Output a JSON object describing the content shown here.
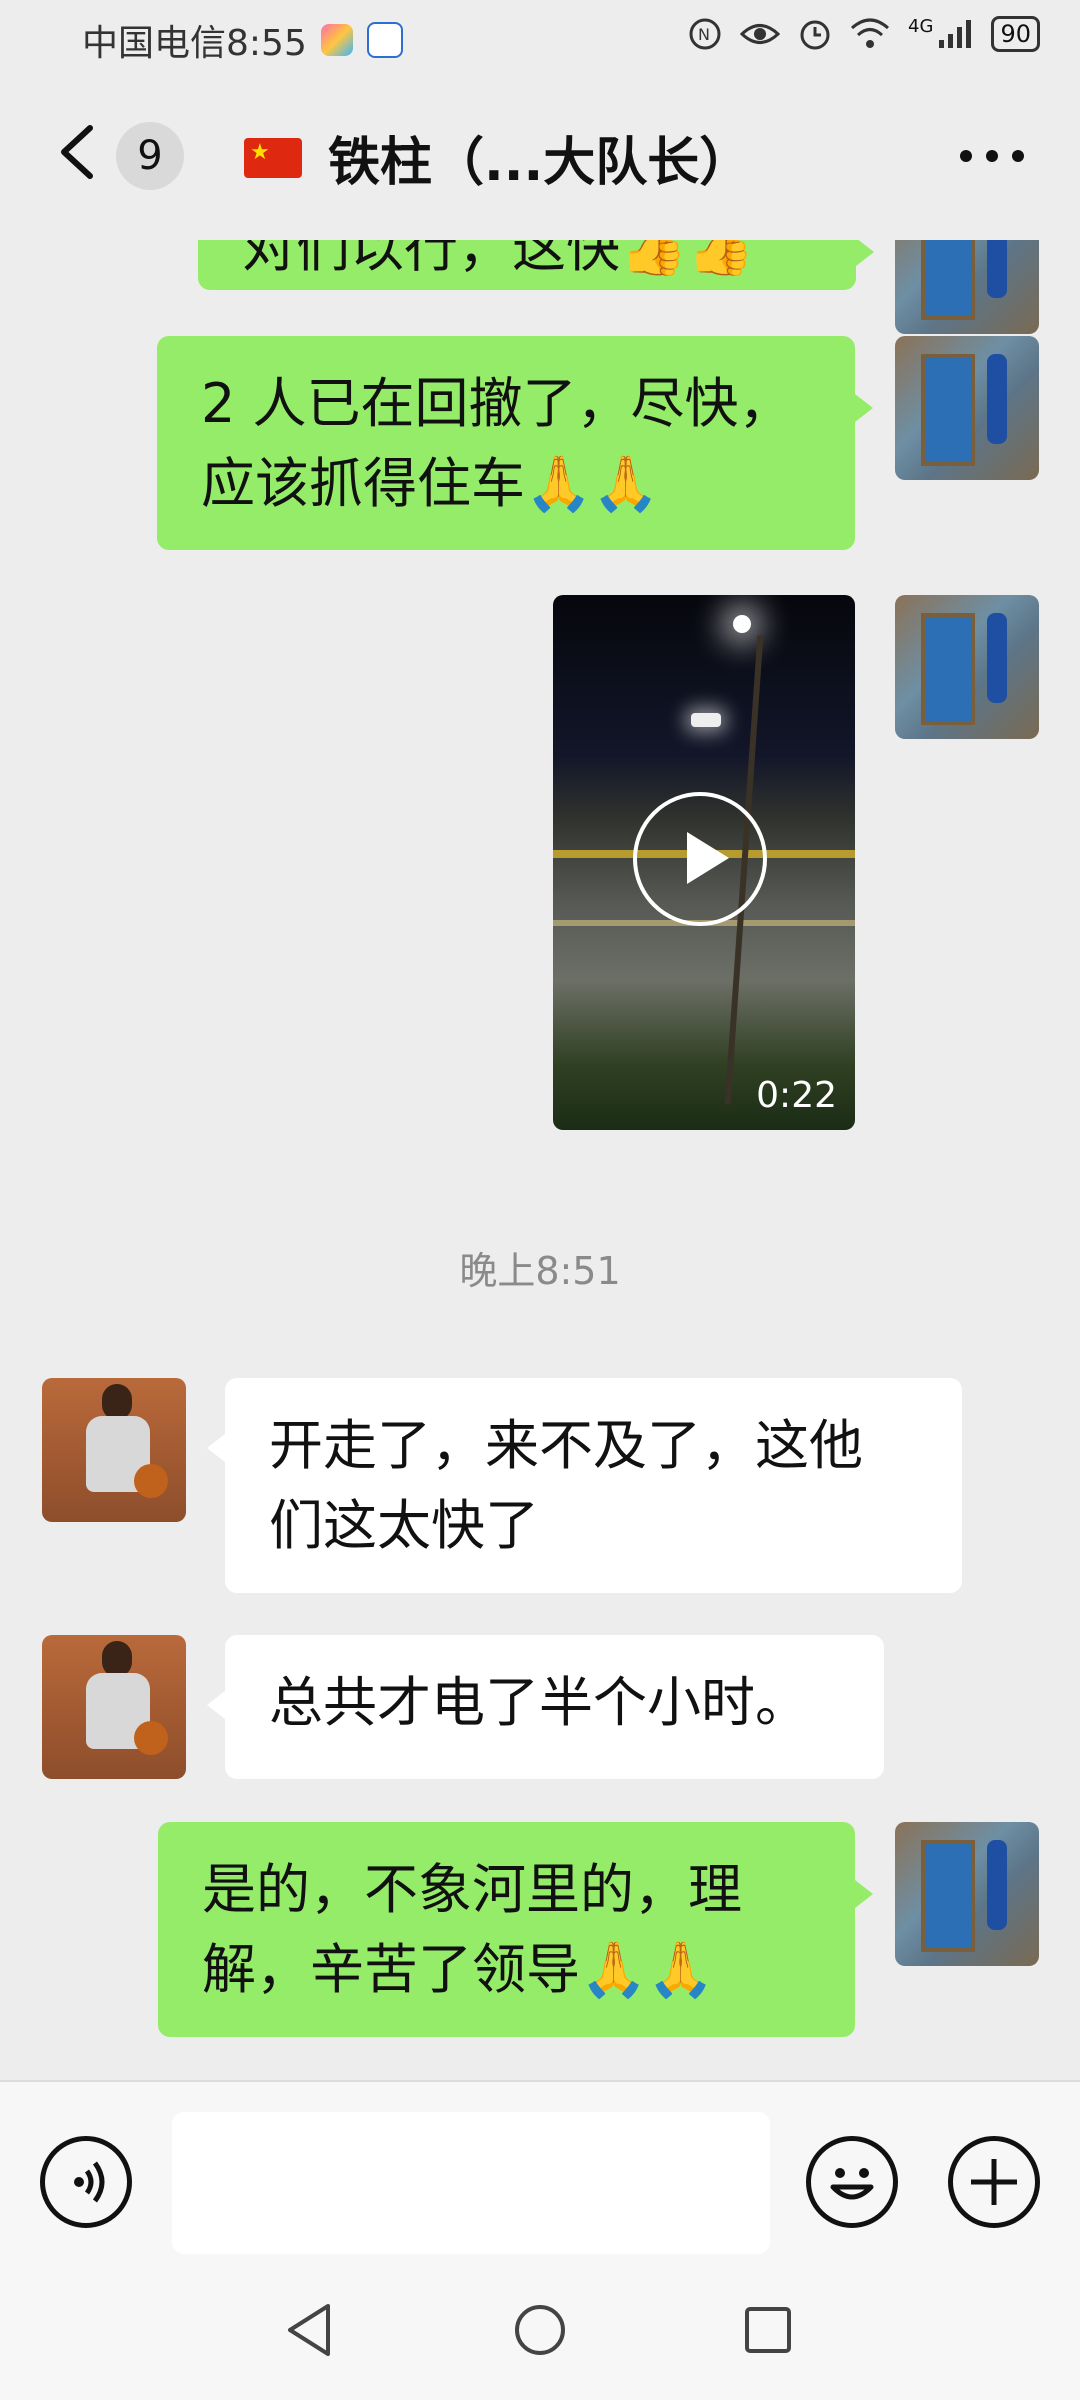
{
  "status_bar": {
    "carrier_time": "中国电信8:55",
    "battery": "90",
    "network": "4G"
  },
  "header": {
    "unread_count": "9",
    "title": "铁柱（...大队长）",
    "flag": "🇨🇳"
  },
  "messages": [
    {
      "sender": "me",
      "type": "text",
      "text": "对们以行，这快👍👍"
    },
    {
      "sender": "me",
      "type": "text",
      "line1": "2 人已在回撤了，尽快，",
      "line2": "应该抓得住车🙏🙏"
    },
    {
      "sender": "me",
      "type": "video",
      "duration": "0:22"
    },
    {
      "sender": "other",
      "type": "text",
      "line1": "开走了，来不及了，这他",
      "line2": "们这太快了"
    },
    {
      "sender": "other",
      "type": "text",
      "line1": "总共才电了半个小时。"
    },
    {
      "sender": "me",
      "type": "text",
      "line1": "是的，不象河里的，理",
      "line2": "解，辛苦了领导🙏🙏"
    }
  ],
  "time_separator": "晚上8:51",
  "input": {
    "placeholder": ""
  },
  "colors": {
    "my_bubble": "#95ec69",
    "other_bubble": "#ffffff",
    "background": "#ededed"
  }
}
